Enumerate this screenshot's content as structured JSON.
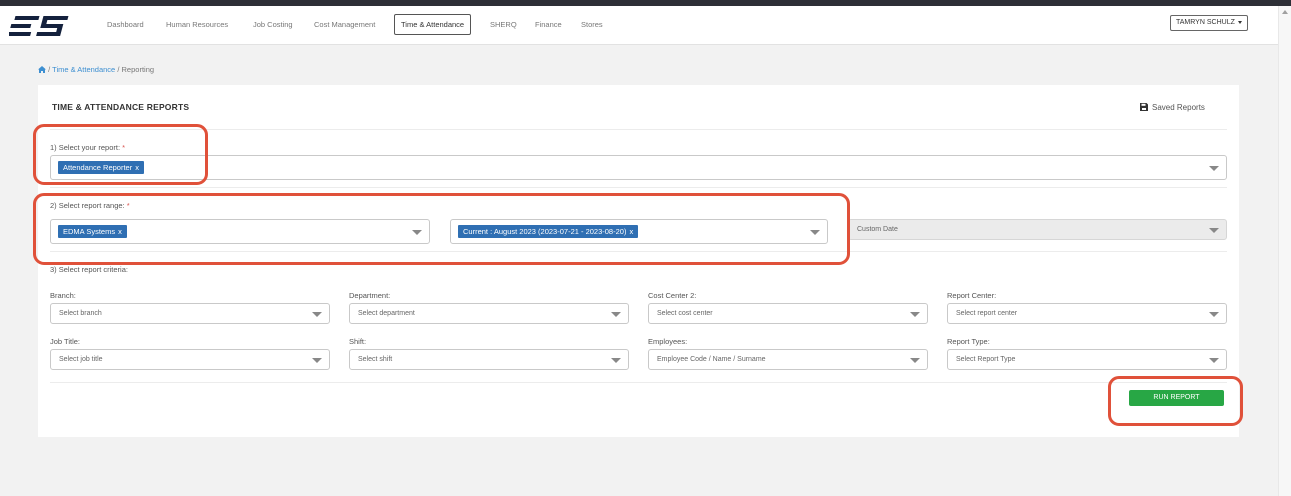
{
  "navbar": {
    "logo_text": "ES",
    "items": [
      "Dashboard",
      "Human Resources",
      "Job Costing",
      "Cost Management",
      "Time & Attendance",
      "SHERQ",
      "Finance",
      "Stores"
    ],
    "user": "TAMRYN SCHULZ"
  },
  "breadcrumb": {
    "section": "Time & Attendance",
    "current": "Reporting",
    "sep": "/"
  },
  "panel": {
    "title": "TIME & ATTENDANCE REPORTS",
    "saved_reports": "Saved Reports"
  },
  "step1": {
    "label": "1) Select your report:",
    "required": "*",
    "tag": "Attendance Reporter",
    "tag_remove": "x"
  },
  "step2": {
    "label": "2) Select report range:",
    "required": "*",
    "company_tag": "EDMA Systems",
    "period_tag": "Current : August 2023 (2023-07-21 - 2023-08-20)",
    "tag_remove": "x",
    "custom_date": "Custom Date"
  },
  "step3": {
    "label": "3) Select report criteria:",
    "fields": [
      {
        "label": "Branch:",
        "placeholder": "Select branch"
      },
      {
        "label": "Department:",
        "placeholder": "Select department"
      },
      {
        "label": "Cost Center 2:",
        "placeholder": "Select cost center"
      },
      {
        "label": "Report Center:",
        "placeholder": "Select report center"
      },
      {
        "label": "Job Title:",
        "placeholder": "Select job title"
      },
      {
        "label": "Shift:",
        "placeholder": "Select shift"
      },
      {
        "label": "Employees:",
        "placeholder": "Employee Code / Name / Surname"
      },
      {
        "label": "Report Type:",
        "placeholder": "Select Report Type"
      }
    ]
  },
  "run_button": "RUN REPORT",
  "colors": {
    "tag_bg": "#2f6fb3",
    "run_button": "#28a745",
    "highlight": "#e0513a",
    "link": "#3d8fd1"
  }
}
